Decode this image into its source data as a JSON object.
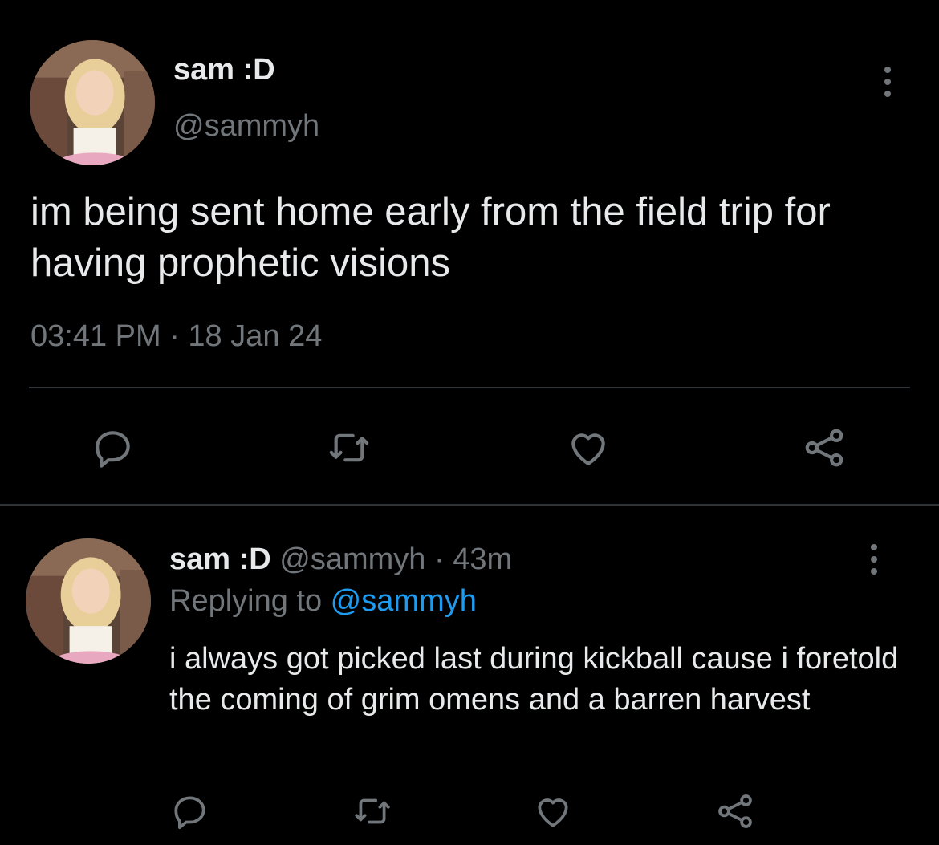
{
  "colors": {
    "background": "#000000",
    "primary_text": "#e7e9ea",
    "secondary_text": "#71767b",
    "divider": "#2f3336",
    "mention": "#1d9bf0"
  },
  "main_tweet": {
    "display_name": "sam :D",
    "handle": "@sammyh",
    "text": "im being sent home early from the field trip for having prophetic visions",
    "timestamp": "03:41 PM · 18 Jan 24",
    "actions": [
      "reply-icon",
      "retweet-icon",
      "like-icon",
      "share-icon"
    ]
  },
  "reply_tweet": {
    "display_name": "sam :D",
    "handle_time": " @sammyh · 43m",
    "replying_prefix": "Replying to ",
    "replying_to": "@sammyh",
    "text": "i always got picked last during kickball cause i foretold the coming of grim omens and a barren harvest",
    "actions": [
      "reply-icon",
      "retweet-icon",
      "like-icon",
      "share-icon"
    ]
  }
}
